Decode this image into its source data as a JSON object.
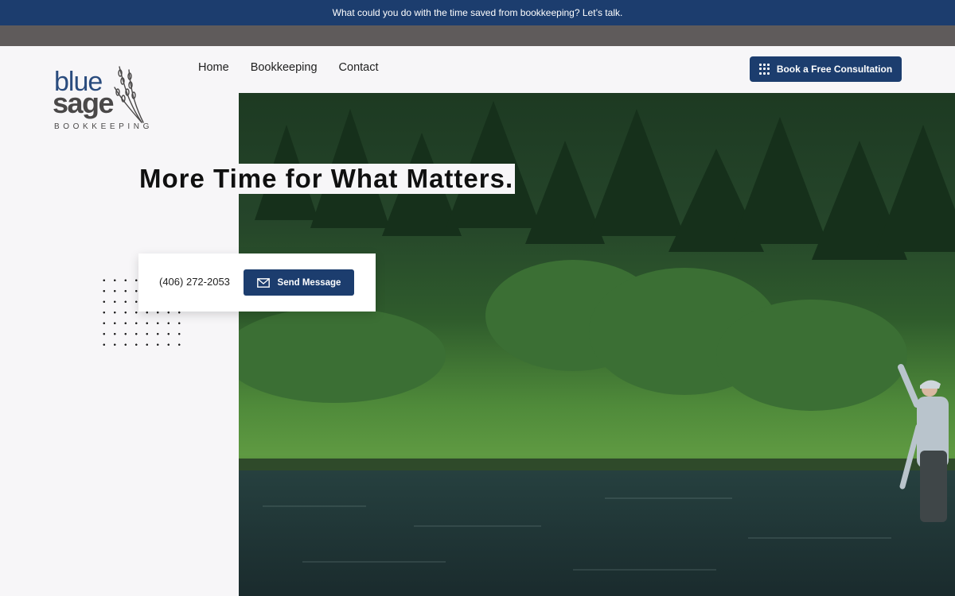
{
  "announcement": "What could you do with the time saved from bookkeeping? Let’s talk.",
  "logo": {
    "line1": "blue",
    "line2": "sage",
    "line3": "BOOKKEEPING"
  },
  "nav": [
    "Home",
    "Bookkeeping",
    "Contact"
  ],
  "cta": {
    "label": "Book a Free Consultation",
    "icon": "grid-dots-icon"
  },
  "hero": {
    "headline": "More Time for What Matters."
  },
  "contact": {
    "phone": "(406) 272-2053",
    "send_label": "Send Message",
    "send_icon": "envelope-icon"
  },
  "colors": {
    "brand": "#1c3d6e",
    "gray_band": "#5f5b5b",
    "background": "#f7f6f8"
  }
}
